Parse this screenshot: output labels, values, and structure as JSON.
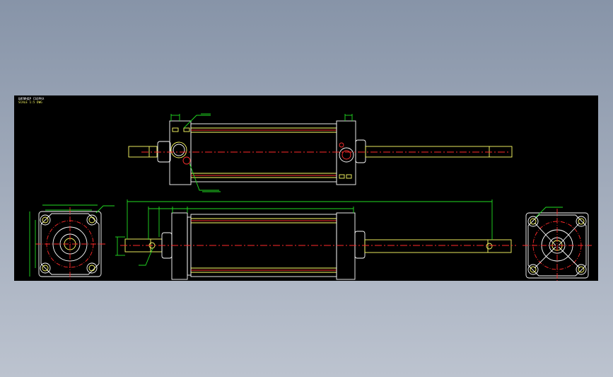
{
  "viewer": {
    "background_top": "#8794a8",
    "background_bottom": "#bcc3cf",
    "canvas_color": "#000000"
  },
  "drawing": {
    "title_line_1": "ЦИЛИНДР СБОРКА",
    "title_line_2": "SCALE 1:5  DWG",
    "colors": {
      "outline": "#ffffff",
      "rod": "#ffff66",
      "centerline": "#ff2a2a",
      "dimension": "#22dd22",
      "port": "#ff3030",
      "title_primary": "#ffffff",
      "title_secondary": "#ffff66"
    }
  }
}
